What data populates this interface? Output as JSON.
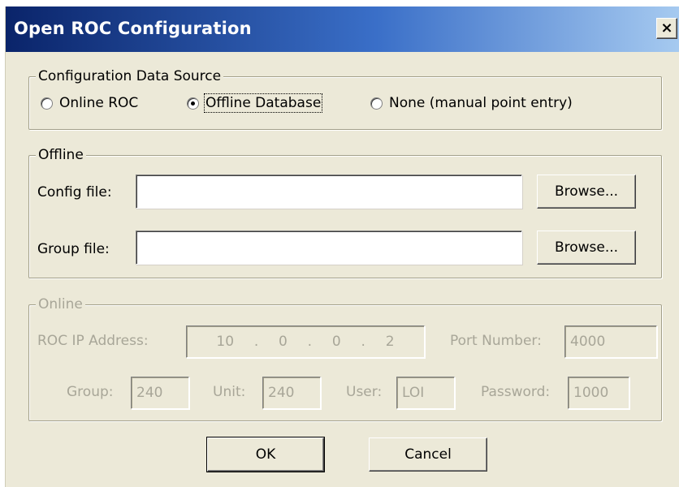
{
  "window": {
    "title": "Open ROC Configuration",
    "close_glyph": "×"
  },
  "source_group": {
    "legend": "Configuration Data Source",
    "options": [
      {
        "label": "Online ROC",
        "selected": false
      },
      {
        "label": "Offline Database",
        "selected": true
      },
      {
        "label": "None (manual point entry)",
        "selected": false
      }
    ]
  },
  "offline_group": {
    "legend": "Offline",
    "config_label": "Config file:",
    "config_value": "",
    "group_label": "Group file:",
    "group_value": "",
    "browse_label": "Browse..."
  },
  "online_group": {
    "legend": "Online",
    "ip_label": "ROC IP Address:",
    "ip_parts": [
      "10",
      ".",
      "0",
      ".",
      "0",
      ".",
      "2"
    ],
    "port_label": "Port Number:",
    "port_value": "4000",
    "group_label": "Group:",
    "group_value": "240",
    "unit_label": "Unit:",
    "unit_value": "240",
    "user_label": "User:",
    "user_value": "LOI",
    "password_label": "Password:",
    "password_value": "1000"
  },
  "buttons": {
    "ok": "OK",
    "cancel": "Cancel"
  }
}
